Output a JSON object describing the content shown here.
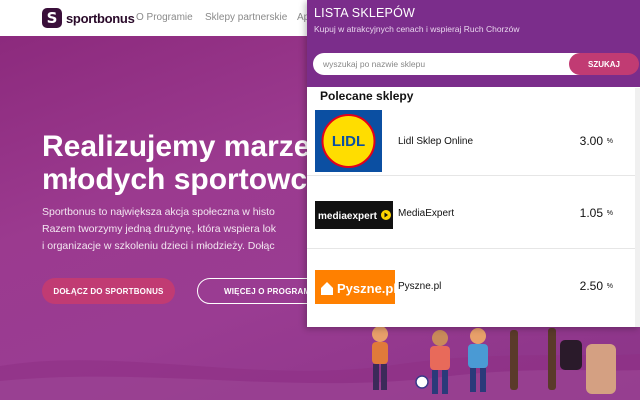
{
  "site": {
    "logo_text": "sportbonus",
    "nav": [
      "O Programie",
      "Sklepy partnerskie",
      "Ap"
    ]
  },
  "hero": {
    "title": "Realizujemy marzen\nmłodych sportowcó",
    "text": "Sportbonus to największa akcja społeczna w histo\nRazem tworzymy jedną drużynę, która wspiera lok\ni organizacje w szkoleniu dzieci i młodzieży. Dołąc",
    "join_button": "DOŁĄCZ DO SPORTBONUS",
    "more_button": "WIĘCEJ O PROGRAMI"
  },
  "popup": {
    "title": "LISTA SKLEPÓW",
    "subtitle": "Kupuj w atrakcyjnych cenach i wspieraj Ruch Chorzów",
    "search_placeholder": "wyszukaj po nazwie sklepu",
    "search_button": "SZUKAJ",
    "section_title": "Polecane sklepy",
    "shops": [
      {
        "name": "Lidl Sklep Online",
        "percent": "3.00",
        "sign": "%",
        "logo_text": "LIDL"
      },
      {
        "name": "MediaExpert",
        "percent": "1.05",
        "sign": "%",
        "logo_text": "mediaexpert"
      },
      {
        "name": "Pyszne.pl",
        "percent": "2.50",
        "sign": "%",
        "logo_text": "Pyszne.pl"
      }
    ]
  },
  "colors": {
    "hero_purple": "#9b3a8f",
    "popup_header": "#7b2d8b",
    "accent_pink": "#c13b73"
  }
}
